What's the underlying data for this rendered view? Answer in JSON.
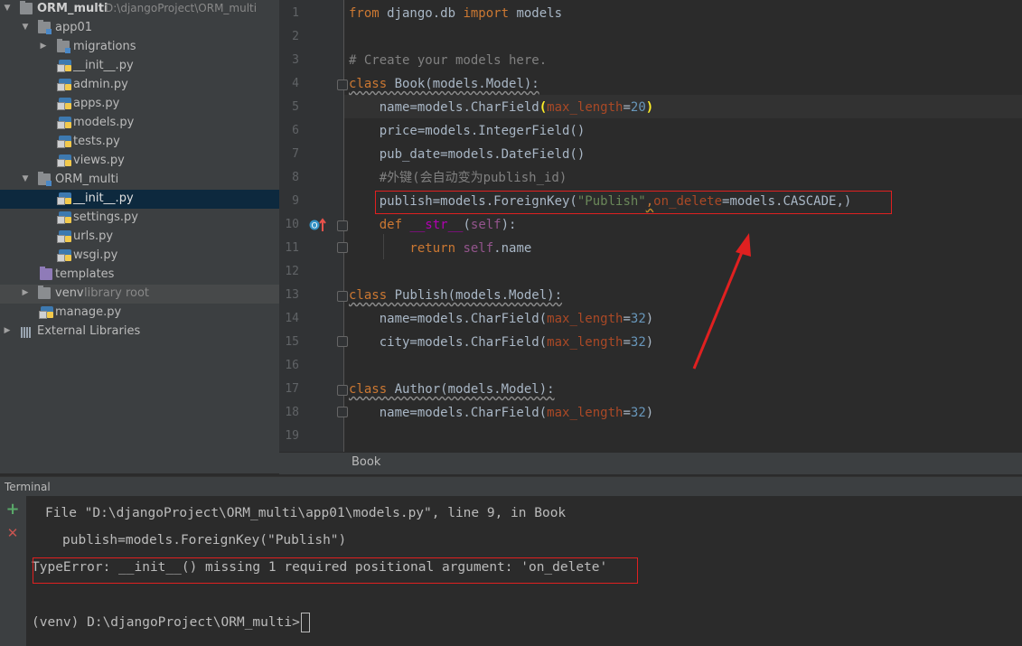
{
  "tree": {
    "project_name": "ORM_multi",
    "project_path": "D:\\djangoProject\\ORM_multi",
    "app_folder": "app01",
    "migrations": "migrations",
    "app_files": [
      "__init__.py",
      "admin.py",
      "apps.py",
      "models.py",
      "tests.py",
      "views.py"
    ],
    "proj_folder": "ORM_multi",
    "proj_files": [
      "__init__.py",
      "settings.py",
      "urls.py",
      "wsgi.py"
    ],
    "templates": "templates",
    "venv": "venv",
    "venv_hint": "library root",
    "manage": "manage.py",
    "external": "External Libraries"
  },
  "editor": {
    "line_numbers": [
      "1",
      "2",
      "3",
      "4",
      "5",
      "6",
      "7",
      "8",
      "9",
      "10",
      "11",
      "12",
      "13",
      "14",
      "15",
      "16",
      "17",
      "18",
      "19"
    ],
    "l1": {
      "from": "from",
      "mod": " django.db ",
      "imp": "import",
      "name": " models"
    },
    "l3": "# Create your models here.",
    "l4": {
      "kw": "class",
      "rest": " Book(models.Model):"
    },
    "l5": {
      "a": "    name",
      "b": "=models.CharField",
      "c": "(",
      "d": "max_length",
      "e": "=",
      "f": "20",
      "g": ")"
    },
    "l6": "    price=models.IntegerField()",
    "l7": "    pub_date=models.DateField()",
    "l8": "    #外键(会自动变为publish_id)",
    "l9": {
      "a": "    publish=models.ForeignKey(",
      "b": "\"Publish\"",
      "c": ",",
      "d": "on_delete",
      "e": "=models.CASCADE,)"
    },
    "l10": {
      "def": "    def ",
      "name": "__str__",
      "open": "(",
      "self": "self",
      "close": "):"
    },
    "l11": {
      "ret": "        return ",
      "self": "self",
      "rest": ".name"
    },
    "l13": {
      "kw": "class",
      "rest": " Publish(models.Model):"
    },
    "l14": {
      "a": "    name=models.CharField(",
      "p": "max_length",
      "e": "=",
      "n": "32",
      "c": ")"
    },
    "l15": {
      "a": "    city=models.CharField(",
      "p": "max_length",
      "e": "=",
      "n": "32",
      "c": ")"
    },
    "l17": {
      "kw": "class",
      "rest": " Author(models.Model):"
    },
    "l18": {
      "a": "    name=models.CharField(",
      "p": "max_length",
      "e": "=",
      "n": "32",
      "c": ")"
    },
    "breadcrumb": "Book"
  },
  "terminal": {
    "title": "Terminal",
    "line1": "File \"D:\\djangoProject\\ORM_multi\\app01\\models.py\", line 9, in Book",
    "line2": "publish=models.ForeignKey(\"Publish\")",
    "line3": "TypeError: __init__() missing 1 required positional argument: 'on_delete'",
    "prompt": "(venv) D:\\djangoProject\\ORM_multi>",
    "add_icon": "+",
    "close_icon": "✕"
  },
  "colors": {
    "accent_red": "#e02020",
    "keyword": "#cc7832",
    "string": "#6a8759",
    "number": "#6897bb",
    "selection": "#0d293e"
  }
}
